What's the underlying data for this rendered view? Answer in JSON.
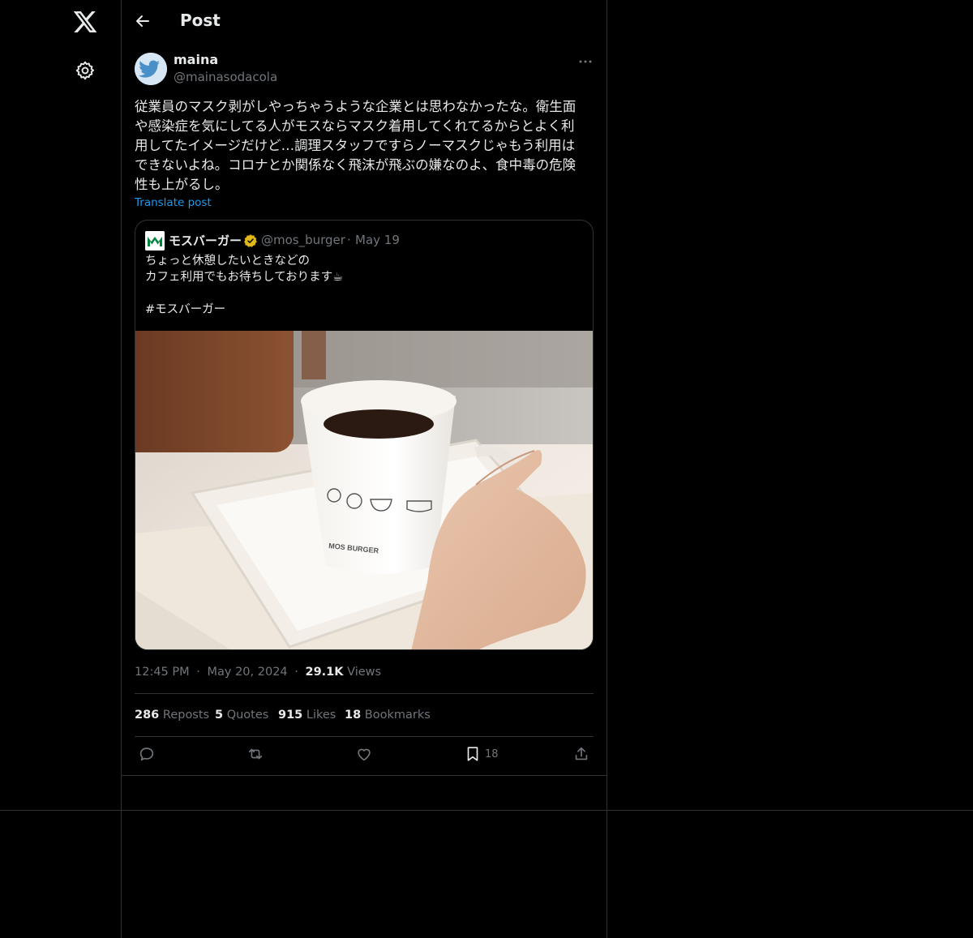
{
  "header": {
    "title": "Post"
  },
  "post": {
    "author": {
      "name": "maina",
      "handle": "@mainasodacola"
    },
    "text": "従業員のマスク剥がしやっちゃうような企業とは思わなかったな。衛生面\nや感染症を気にしてる人がモスならマスク着用してくれてるからとよく利\n用してたイメージだけど…調理スタッフですらノーマスクじゃもう利用は\nできないよね。コロナとか関係なく飛沫が飛ぶの嫌なのよ、食中毒の危険\n性も上がるし。",
    "translate_label": "Translate post",
    "quote": {
      "name": "モスバーガー",
      "handle": "@mos_burger",
      "separator": "·",
      "date": "May 19",
      "text": "ちょっと休憩したいときなどの\nカフェ利用でもお待ちしております☕\n\n#モスバーガー",
      "image_cup_text": "MOS BURGER"
    },
    "meta": {
      "time": "12:45 PM",
      "sep1": "·",
      "date": "May 20, 2024",
      "sep2": "·",
      "views_count": "29.1K",
      "views_label": "Views"
    },
    "stats": {
      "reposts_count": "286",
      "reposts_label": "Reposts",
      "quotes_count": "5",
      "quotes_label": "Quotes",
      "likes_count": "915",
      "likes_label": "Likes",
      "bookmarks_count": "18",
      "bookmarks_label": "Bookmarks"
    },
    "actions": {
      "bookmark_count": "18"
    }
  },
  "icons": [
    "x-logo-icon",
    "gear-icon",
    "back-arrow-icon",
    "more-icon",
    "verified-icon",
    "reply-icon",
    "repost-icon",
    "like-icon",
    "bookmark-icon",
    "share-icon"
  ],
  "colors": {
    "background": "#000000",
    "text": "#e7e9ea",
    "muted": "#71767b",
    "link": "#1d9bf0",
    "border": "#2f3336",
    "verified": "#e2b719",
    "mos_green": "#00843d"
  }
}
